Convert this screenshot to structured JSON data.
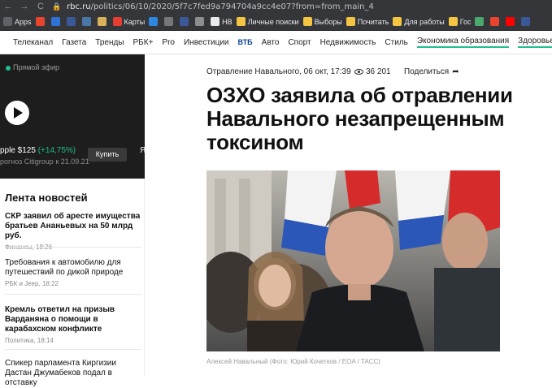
{
  "browser": {
    "back": "←",
    "forward": "→",
    "reload": "C",
    "url_host": "rbc.ru",
    "url_path": "/politics/06/10/2020/5f7c7fed9a794704a9cc4e07?from=from_main_4",
    "bookmarks": [
      {
        "label": "Apps",
        "color": "#5f6368"
      },
      {
        "label": "",
        "color": "#e8432d"
      },
      {
        "label": "",
        "color": "#2f72d6"
      },
      {
        "label": "",
        "color": "#3b5998"
      },
      {
        "label": "",
        "color": "#4a76a8"
      },
      {
        "label": "",
        "color": "#d8b15a"
      },
      {
        "label": "Карты",
        "color": "#e63e30"
      },
      {
        "label": "",
        "color": "#2e86de"
      },
      {
        "label": "",
        "color": "#777777"
      },
      {
        "label": "",
        "color": "#3b5998"
      },
      {
        "label": "",
        "color": "#8e8e8e"
      },
      {
        "label": "НВ",
        "color": "#e8eaed"
      },
      {
        "label": "Личные поиски",
        "color": "#f4c542"
      },
      {
        "label": "Выборы",
        "color": "#f4c542"
      },
      {
        "label": "Почитать",
        "color": "#f4c542"
      },
      {
        "label": "Для работы",
        "color": "#f4c542"
      },
      {
        "label": "Гос",
        "color": "#f4c542"
      },
      {
        "label": "",
        "color": "#4aa96c"
      },
      {
        "label": "",
        "color": "#e8432d"
      },
      {
        "label": "",
        "color": "#ff0000"
      },
      {
        "label": "",
        "color": "#3b5998"
      }
    ]
  },
  "topnav": {
    "items": [
      "Телеканал",
      "Газета",
      "Тренды",
      "РБК+",
      "Pro",
      "Инвестиции"
    ],
    "vtb": "ВТБ",
    "items2": [
      "Авто",
      "Спорт",
      "Недвижимость",
      "Стиль"
    ],
    "underlined": [
      "Экономика образования",
      "Здоровье"
    ],
    "more": "•••"
  },
  "live": {
    "label": "Прямой эфир",
    "ticker": "pple $125",
    "ticker_pct": "(+14,75%)",
    "ticker_sub": "рогноз Citigroup к 21.09.21",
    "buy": "Купить",
    "ticker2": "Я"
  },
  "feed": {
    "title": "Лента новостей",
    "items": [
      {
        "headline": "СКР заявил об аресте имущества братьев Ананьевых на 50 млрд руб.",
        "meta": "Финансы, 18:26",
        "bold": true
      },
      {
        "headline": "Требования к автомобилю для путешествий по дикой природе",
        "meta": "РБК и Jeep, 18:22",
        "bold": false
      },
      {
        "headline": "Кремль ответил на призыв Варданяна о помощи в карабахском конфликте",
        "meta": "Политика, 18:14",
        "bold": true
      },
      {
        "headline": "Спикер парламента Киргизии Дастан Джумабеков подал в отставку",
        "meta": "",
        "bold": false
      }
    ]
  },
  "article": {
    "rubric": "Отравление Навального, 06 окт, 17:39",
    "views": "36 201",
    "share": "Поделиться",
    "headline": "ОЗХО заявила об отравлении Навального незапрещенным токсином",
    "caption": "Алексей Навальный (Фото: Юрий Кочетков / EOA / ТАСС)"
  },
  "colors": {
    "accent": "#1fbf8f",
    "dark_bg": "#1d1d1d",
    "chrome": "#35363a"
  }
}
